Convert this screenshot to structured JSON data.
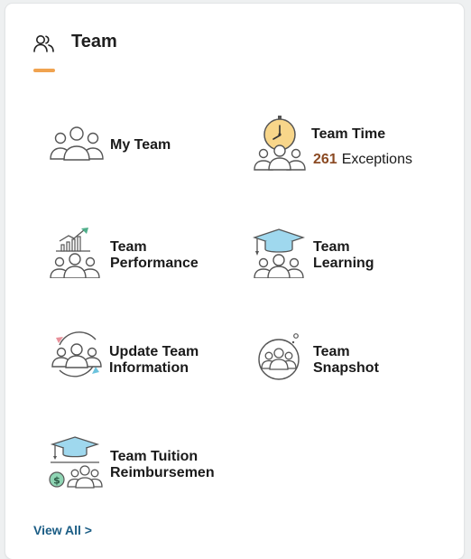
{
  "header": {
    "title": "Team",
    "icon": "people-icon",
    "accent_color": "#f0a350"
  },
  "tiles": [
    {
      "label_lines": [
        "My Team"
      ],
      "icon": "team-group-icon"
    },
    {
      "label_lines": [
        "Team Time"
      ],
      "icon": "team-clock-icon",
      "exceptions_count": "261",
      "exceptions_label": "Exceptions",
      "count_color": "#8b4a23"
    },
    {
      "label_lines": [
        "Team",
        "Performance"
      ],
      "icon": "team-chart-icon"
    },
    {
      "label_lines": [
        "Team",
        "Learning"
      ],
      "icon": "team-graduation-cap-icon"
    },
    {
      "label_lines": [
        "Update Team",
        "Information"
      ],
      "icon": "team-refresh-icon"
    },
    {
      "label_lines": [
        "Team",
        "Snapshot"
      ],
      "icon": "team-snapshot-icon"
    },
    {
      "label_lines": [
        "Team Tuition",
        "Reimbursemen"
      ],
      "icon": "team-tuition-icon"
    }
  ],
  "footer": {
    "view_all_label": "View All >",
    "link_color": "#1b5d85"
  }
}
